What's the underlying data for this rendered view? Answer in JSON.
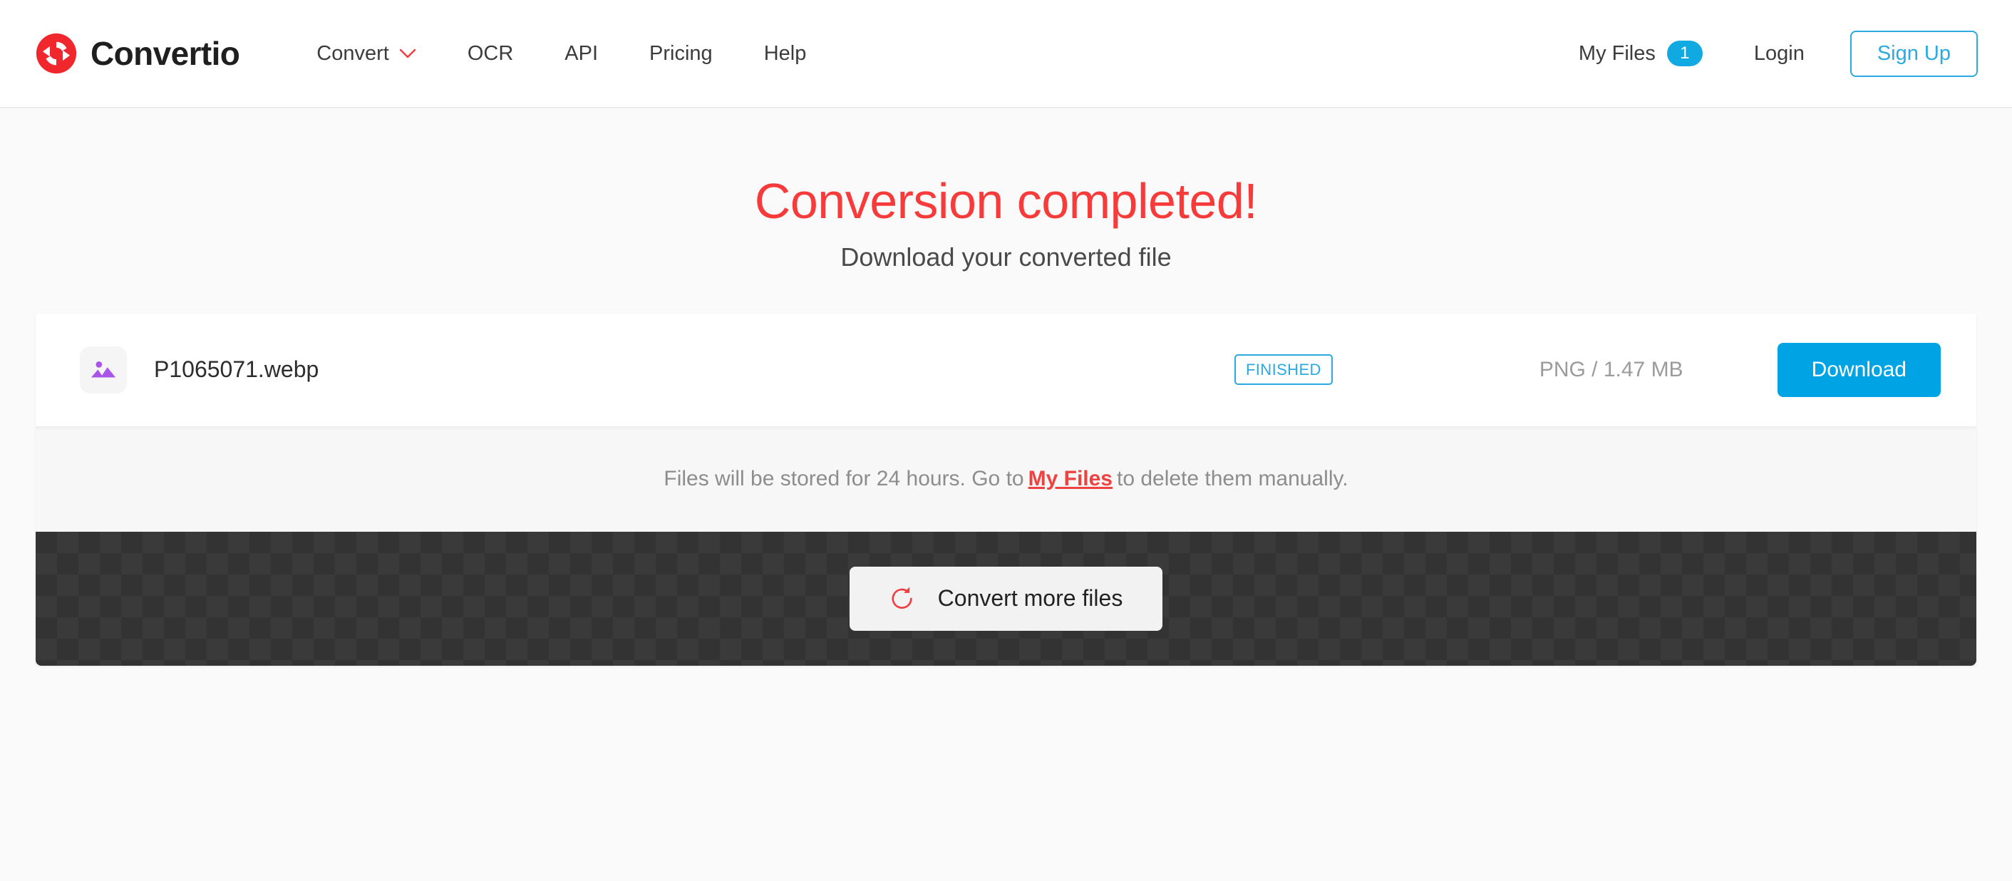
{
  "brand": {
    "name": "Convertio",
    "logo_icon": "convertio-circular-arrows-icon",
    "accent_red": "#f03c3c"
  },
  "header": {
    "nav": [
      {
        "label": "Convert",
        "has_dropdown": true,
        "dropdown_icon": "chevron-down-icon"
      },
      {
        "label": "OCR",
        "has_dropdown": false
      },
      {
        "label": "API",
        "has_dropdown": false
      },
      {
        "label": "Pricing",
        "has_dropdown": false
      },
      {
        "label": "Help",
        "has_dropdown": false
      }
    ],
    "my_files_label": "My Files",
    "my_files_count": "1",
    "login_label": "Login",
    "signup_label": "Sign Up",
    "badge_color": "#11a9e2",
    "signup_color": "#2aaae1"
  },
  "hero": {
    "title": "Conversion completed!",
    "subtitle": "Download your converted file",
    "title_color": "#f73b3b"
  },
  "file": {
    "type_icon": "image-file-icon",
    "icon_color": "#a855e8",
    "name": "P1065071.webp",
    "status": "FINISHED",
    "status_color": "#2aaae1",
    "meta": "PNG / 1.47 MB",
    "download_label": "Download",
    "download_color": "#00a4e4"
  },
  "info": {
    "text_before": "Files will be stored for 24 hours. Go to",
    "link_label": "My Files",
    "text_after": "to delete them manually.",
    "link_color": "#f04141"
  },
  "footer": {
    "convert_more_label": "Convert more files",
    "refresh_icon": "refresh-icon",
    "refresh_color": "#ef3e42"
  }
}
